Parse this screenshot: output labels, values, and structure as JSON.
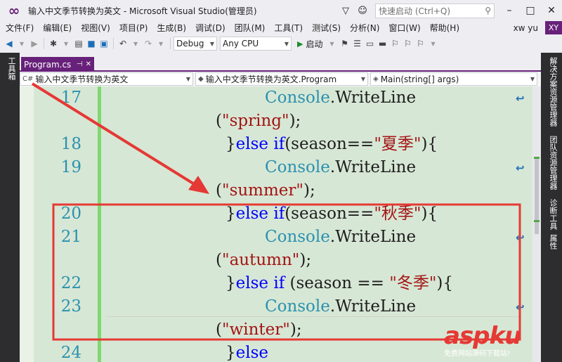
{
  "window": {
    "title": "输入中文季节转换为英文 - Microsoft Visual Studio(管理员)",
    "quick_launch_placeholder": "快速启动 (Ctrl+Q)"
  },
  "menu": {
    "items": [
      "文件(F)",
      "编辑(E)",
      "视图(V)",
      "项目(P)",
      "生成(B)",
      "调试(D)",
      "团队(M)",
      "工具(T)",
      "测试(S)",
      "分析(N)",
      "窗口(W)",
      "帮助(H)"
    ],
    "user_name": "xw yu",
    "user_initials": "XY"
  },
  "toolbar": {
    "config": "Debug",
    "platform": "Any CPU",
    "start_label": "启动"
  },
  "side_panels": {
    "left": "工具箱",
    "right": [
      "解决方案资源管理器",
      "团队资源管理器",
      "诊断工具",
      "属性"
    ]
  },
  "editor": {
    "tab_label": "Program.cs",
    "nav": {
      "project": "输入中文季节转换为英文",
      "class": "输入中文季节转换为英文.Program",
      "member": "Main(string[] args)"
    },
    "lines": [
      {
        "num": "17",
        "tokens": [
          {
            "t": "Console",
            "c": "tp"
          },
          {
            "t": ".WriteLine",
            "c": "pl"
          }
        ]
      },
      {
        "num": "",
        "tokens": [
          {
            "t": "(",
            "c": "pl"
          },
          {
            "t": "\"spring\"",
            "c": "st"
          },
          {
            "t": ");",
            "c": "pl"
          }
        ]
      },
      {
        "num": "18",
        "tokens": [
          {
            "t": "}",
            "c": "pl"
          },
          {
            "t": "else if",
            "c": "kw"
          },
          {
            "t": "(season==",
            "c": "pl"
          },
          {
            "t": "\"夏季\"",
            "c": "st"
          },
          {
            "t": "){",
            "c": "pl"
          }
        ]
      },
      {
        "num": "19",
        "tokens": [
          {
            "t": "Console",
            "c": "tp"
          },
          {
            "t": ".WriteLine",
            "c": "pl"
          }
        ]
      },
      {
        "num": "",
        "tokens": [
          {
            "t": "(",
            "c": "pl"
          },
          {
            "t": "\"summer\"",
            "c": "st"
          },
          {
            "t": ");",
            "c": "pl"
          }
        ]
      },
      {
        "num": "20",
        "tokens": [
          {
            "t": "}",
            "c": "pl"
          },
          {
            "t": "else if",
            "c": "kw"
          },
          {
            "t": "(season==",
            "c": "pl"
          },
          {
            "t": "\"秋季\"",
            "c": "st"
          },
          {
            "t": "){",
            "c": "pl"
          }
        ]
      },
      {
        "num": "21",
        "tokens": [
          {
            "t": "Console",
            "c": "tp"
          },
          {
            "t": ".WriteLine",
            "c": "pl"
          }
        ]
      },
      {
        "num": "",
        "tokens": [
          {
            "t": "(",
            "c": "pl"
          },
          {
            "t": "\"autumn\"",
            "c": "st"
          },
          {
            "t": ");",
            "c": "pl"
          }
        ]
      },
      {
        "num": "22",
        "tokens": [
          {
            "t": "}",
            "c": "pl"
          },
          {
            "t": "else if ",
            "c": "kw"
          },
          {
            "t": "(season == ",
            "c": "pl"
          },
          {
            "t": "\"冬季\"",
            "c": "st"
          },
          {
            "t": "){",
            "c": "pl"
          }
        ]
      },
      {
        "num": "23",
        "tokens": [
          {
            "t": "Console",
            "c": "tp"
          },
          {
            "t": ".WriteLine",
            "c": "pl"
          }
        ]
      },
      {
        "num": "",
        "tokens": [
          {
            "t": "(",
            "c": "pl"
          },
          {
            "t": "\"winter\"",
            "c": "st"
          },
          {
            "t": ");",
            "c": "pl"
          }
        ]
      },
      {
        "num": "24",
        "tokens": [
          {
            "t": "}",
            "c": "pl"
          },
          {
            "t": "else",
            "c": "kw"
          }
        ]
      }
    ]
  },
  "watermark": {
    "logo": "aspku",
    "tagline": "免费网站源码下载站!"
  },
  "colors": {
    "accent": "#68217a",
    "editor_bg": "#d7e7d5",
    "annotation": "#e53935",
    "keyword": "#0000ff",
    "type": "#2b91af",
    "string": "#a31515"
  }
}
